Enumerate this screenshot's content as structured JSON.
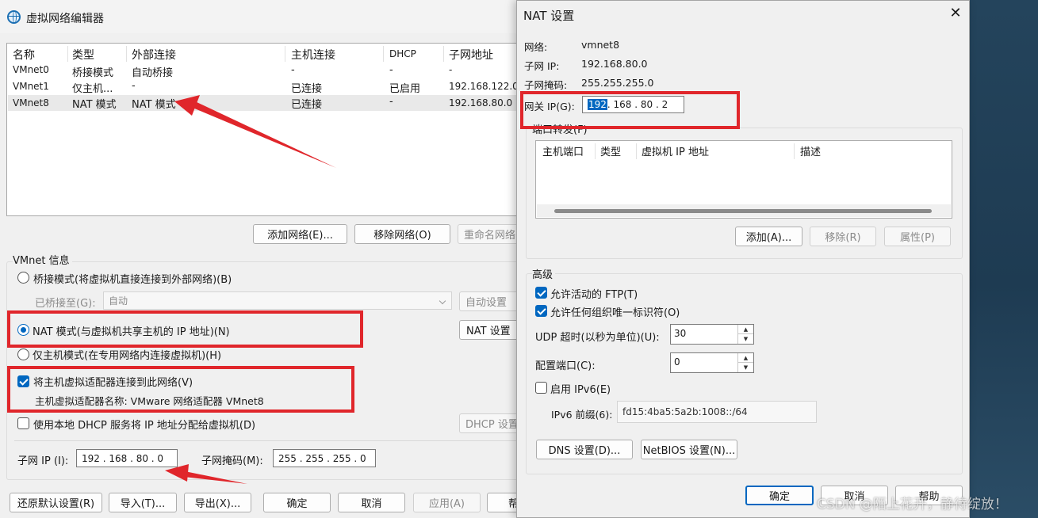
{
  "main_window": {
    "title": "虚拟网络编辑器",
    "columns": [
      "名称",
      "类型",
      "外部连接",
      "主机连接",
      "DHCP",
      "子网地址"
    ],
    "rows": [
      {
        "name": "VMnet0",
        "type": "桥接模式",
        "external": "自动桥接",
        "host": "-",
        "dhcp": "-",
        "subnet": "-"
      },
      {
        "name": "VMnet1",
        "type": "仅主机...",
        "external": "-",
        "host": "已连接",
        "dhcp": "已启用",
        "subnet": "192.168.122.0"
      },
      {
        "name": "VMnet8",
        "type": "NAT 模式",
        "external": "NAT 模式",
        "host": "已连接",
        "dhcp": "-",
        "subnet": "192.168.80.0"
      }
    ],
    "add_network": "添加网络(E)...",
    "remove_network": "移除网络(O)",
    "rename_network": "重命名网络",
    "vmnet_info_label": "VMnet 信息",
    "bridge_mode": "桥接模式(将虚拟机直接连接到外部网络)(B)",
    "bridged_to_label": "已桥接至(G):",
    "bridged_to_value": "自动",
    "auto_settings": "自动设置",
    "nat_mode": "NAT 模式(与虚拟机共享主机的 IP 地址)(N)",
    "nat_settings": "NAT 设置",
    "host_only_mode": "仅主机模式(在专用网络内连接虚拟机)(H)",
    "connect_adapter": "将主机虚拟适配器连接到此网络(V)",
    "adapter_name": "主机虚拟适配器名称: VMware 网络适配器 VMnet8",
    "use_dhcp": "使用本地 DHCP 服务将 IP 地址分配给虚拟机(D)",
    "dhcp_settings": "DHCP 设置",
    "subnet_ip_label": "子网 IP (I):",
    "subnet_ip_value": "192 . 168 . 80  .  0",
    "subnet_mask_label": "子网掩码(M):",
    "subnet_mask_value": "255 . 255 . 255 .  0",
    "restore_defaults": "还原默认设置(R)",
    "import": "导入(T)...",
    "export": "导出(X)...",
    "ok": "确定",
    "cancel": "取消",
    "apply": "应用(A)",
    "help": "帮"
  },
  "nat_dialog": {
    "title": "NAT 设置",
    "close": "✕",
    "network_label": "网络:",
    "network_value": "vmnet8",
    "subnet_ip_label": "子网 IP:",
    "subnet_ip_value": "192.168.80.0",
    "subnet_mask_label": "子网掩码:",
    "subnet_mask_value": "255.255.255.0",
    "gateway_label": "网关 IP(G):",
    "gateway_first": "192",
    "gateway_rest": " . 168 . 80  .  2",
    "port_forwarding_label": "端口转发(F)",
    "pf_columns": [
      "主机端口",
      "类型",
      "虚拟机 IP 地址",
      "描述"
    ],
    "pf_add": "添加(A)...",
    "pf_remove": "移除(R)",
    "pf_properties": "属性(P)",
    "advanced_label": "高级",
    "allow_ftp": "允许活动的 FTP(T)",
    "allow_oui": "允许任何组织唯一标识符(O)",
    "udp_timeout_label": "UDP 超时(以秒为单位)(U):",
    "udp_timeout_value": "30",
    "config_port_label": "配置端口(C):",
    "config_port_value": "0",
    "enable_ipv6": "启用 IPv6(E)",
    "ipv6_prefix_label": "IPv6 前缀(6):",
    "ipv6_prefix_value": "fd15:4ba5:5a2b:1008::/64",
    "dns_settings": "DNS 设置(D)...",
    "netbios_settings": "NetBIOS 设置(N)...",
    "ok": "确定",
    "cancel": "取消",
    "help": "帮助"
  },
  "watermark": "CSDN @陌上花开，静待绽放！",
  "colors": {
    "accent": "#0067c0",
    "highlight": "#e0262b"
  }
}
